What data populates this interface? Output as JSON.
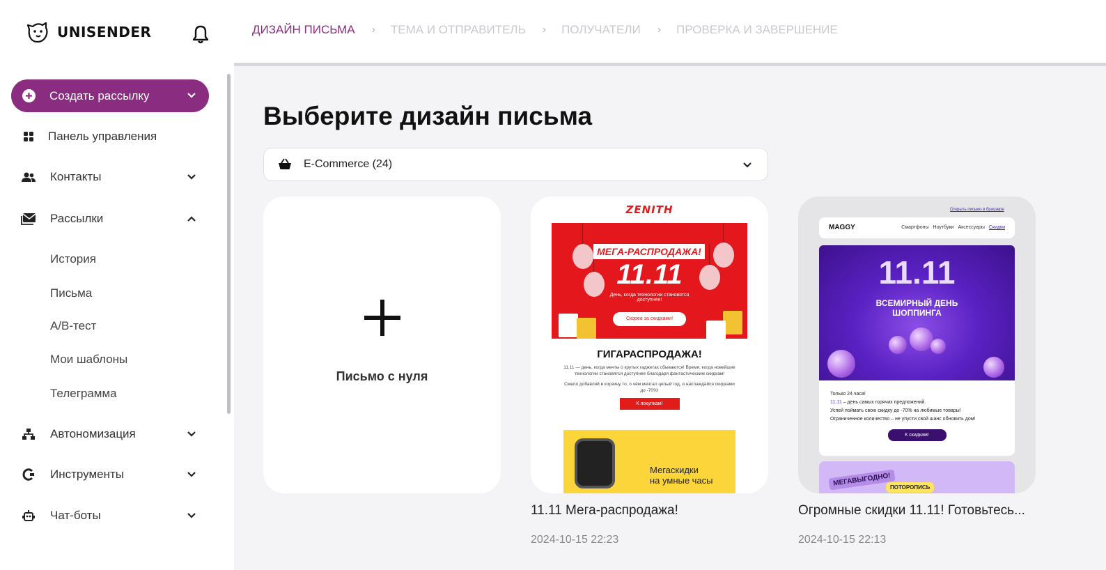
{
  "app": {
    "name": "UNISENDER"
  },
  "sidebar": {
    "create_button": "Создать рассылку",
    "items": [
      {
        "label": "Панель управления"
      },
      {
        "label": "Контакты"
      },
      {
        "label": "Рассылки"
      },
      {
        "label": "Автономизация"
      },
      {
        "label": "Инструменты"
      },
      {
        "label": "Чат-боты"
      }
    ],
    "subitems": [
      {
        "label": "История"
      },
      {
        "label": "Письма"
      },
      {
        "label": "A/B-тест"
      },
      {
        "label": "Мои шаблоны"
      },
      {
        "label": "Телеграмма"
      }
    ]
  },
  "wizard": {
    "steps": [
      {
        "label": "ДИЗАЙН ПИСЬМА",
        "active": true
      },
      {
        "label": "ТЕМА И ОТПРАВИТЕЛЬ",
        "active": false
      },
      {
        "label": "ПОЛУЧАТЕЛИ",
        "active": false
      },
      {
        "label": "ПРОВЕРКА И ЗАВЕРШЕНИЕ",
        "active": false
      }
    ]
  },
  "main": {
    "heading": "Выберите дизайн письма",
    "category": "E-Commerce (24)",
    "blank_card_label": "Письмо с нуля",
    "templates": [
      {
        "title": "11.11 Мега-распродажа!",
        "date": "2024-10-15 22:23"
      },
      {
        "title": "Огромные скидки 11.11! Готовьтесь...",
        "date": "2024-10-15 22:13"
      }
    ]
  },
  "preview1": {
    "logo": "ZENITH",
    "banner": "МЕГА-РАСПРОДАЖА!",
    "big": "11.11",
    "tagline": "День, когда технологии становятся доступнее!",
    "cta": "Скорее за скидками!",
    "h": "ГИГАРАСПРОДАЖА!",
    "text1": "11.11 — день, когда мечты о крутых гаджетах сбываются! Время, когда новейшие технологии становятся доступнее благодаря фантастическим скидкам!",
    "text2": "Смело добавляй в корзину то, о чём мечтал целый год, и наслаждайся скидками до -70%!",
    "btn": "К покупкам!",
    "watch_text_1": "Мегаскидки",
    "watch_text_2": "на умные часы"
  },
  "preview2": {
    "link": "Открыть письмо в браузере",
    "brand": "MAGGY",
    "menu": [
      "Смартфоны",
      "Ноутбуки",
      "Аксессуары",
      "Скидки"
    ],
    "big": "11.11",
    "sub1": "ВСЕМИРНЫЙ ДЕНЬ",
    "sub2": "ШОППИНГА",
    "line1": "Только 24 часа!",
    "line2_hl": "11.11",
    "line2": " – день самых горячих предложений.",
    "line3": "Успей поймать свою скидку до -70% на любимые товары!",
    "line4": "Ограниченное количество – не упусти свой шанс обновить дом!",
    "btn": "К скидкам!",
    "promo1": "МЕГАВЫГОДНО!",
    "promo2": "ПОТОРОПИСЬ"
  },
  "colors": {
    "accent": "#8a2d80",
    "muted_step": "#c9c9cf",
    "background": "#f4f4f7"
  }
}
